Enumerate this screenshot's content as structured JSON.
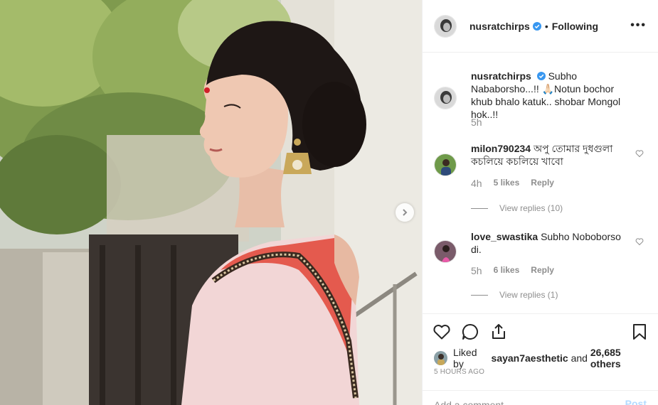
{
  "header": {
    "username": "nusratchirps",
    "separator": "•",
    "follow_status": "Following",
    "more_label": "•••"
  },
  "caption": {
    "username": "nusratchirps",
    "text": "Subho Nababorsho...!! 🙏🏻Notun bochor khub bhalo katuk.. shobar Mongol hok..!!",
    "time": "5h"
  },
  "comments": [
    {
      "username": "milon790234",
      "text": "অপু তোমার দুধগুলা কচলিয়ে কচলিয়ে খাবো",
      "time": "4h",
      "likes": "5 likes",
      "reply": "Reply",
      "view_replies": "View replies (10)"
    },
    {
      "username": "love_swastika",
      "text": "Subho Noboborso di.",
      "time": "5h",
      "likes": "6 likes",
      "reply": "Reply",
      "view_replies": "View replies (1)"
    }
  ],
  "likes_line": {
    "prefix": "Liked by",
    "user": "sayan7aesthetic",
    "middle": "and",
    "count": "26,685 others"
  },
  "timestamp": "5 HOURS AGO",
  "composer": {
    "placeholder": "Add a comment...",
    "post_label": "Post"
  },
  "icons": {
    "verified": "verified-badge-icon",
    "like": "heart-icon",
    "comment": "speech-bubble-icon",
    "share": "share-icon",
    "save": "bookmark-icon",
    "next": "chevron-right-icon"
  },
  "colors": {
    "verified_blue": "#3897f0",
    "post_button_disabled": "#b3dbff",
    "muted_text": "#8e8e8e"
  }
}
